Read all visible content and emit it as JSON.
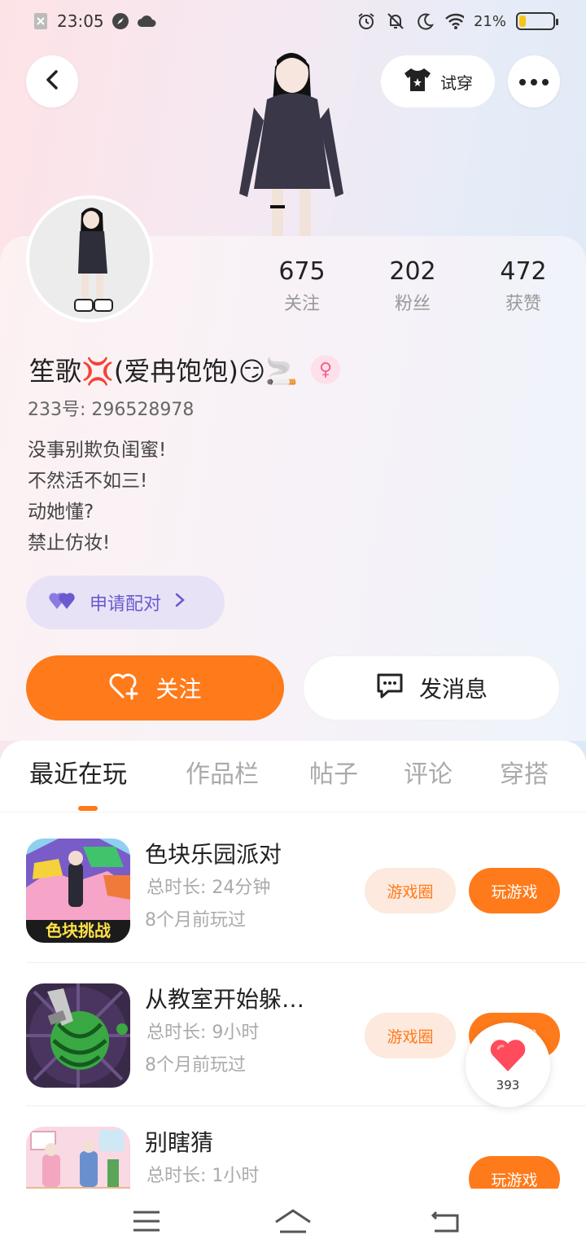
{
  "status_bar": {
    "time": "23:05",
    "battery_text": "21%",
    "battery_level": 0.21
  },
  "header": {
    "try_on_label": "试穿"
  },
  "profile": {
    "stats": [
      {
        "value": "675",
        "label": "关注"
      },
      {
        "value": "202",
        "label": "粉丝"
      },
      {
        "value": "472",
        "label": "获赞"
      }
    ],
    "name": "笙歌💢(爱冉饱饱)😏🚬",
    "gender_symbol": "♀",
    "user_id": "233号: 296528978",
    "bio": [
      "没事别欺负闺蜜!",
      "不然活不如三!",
      "动她懂?",
      "禁止仿妆!"
    ],
    "pair_label": "申请配对",
    "follow_label": "关注",
    "message_label": "发消息"
  },
  "tabs": [
    {
      "label": "最近在玩",
      "active": true
    },
    {
      "label": "作品栏",
      "active": false
    },
    {
      "label": "帖子",
      "active": false
    },
    {
      "label": "评论",
      "active": false
    },
    {
      "label": "穿搭",
      "active": false
    }
  ],
  "games": [
    {
      "title": "色块乐园派对",
      "duration": "总时长: 24分钟",
      "last_played": "8个月前玩过",
      "thumb_text": "色块挑战",
      "circle_label": "游戏圈",
      "play_label": "玩游戏"
    },
    {
      "title": "从教室开始躲…",
      "duration": "总时长: 9小时",
      "last_played": "8个月前玩过",
      "thumb_text": "",
      "circle_label": "游戏圈",
      "play_label": "玩游戏"
    },
    {
      "title": "别瞎猜",
      "duration": "总时长: 1小时",
      "last_played": "",
      "thumb_text": "",
      "circle_label": "",
      "play_label": "玩游戏"
    }
  ],
  "like_float": {
    "count": "393"
  },
  "colors": {
    "accent": "#ff7a1a",
    "pair_bg": "#e8e2f7",
    "pair_text": "#6a5acd"
  }
}
